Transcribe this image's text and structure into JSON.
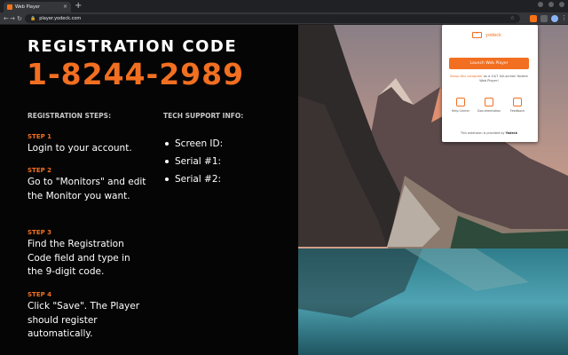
{
  "browser": {
    "tab_title": "Web Player",
    "tab_close": "×",
    "new_tab": "+",
    "url": "player.yodeck.com",
    "icons": {
      "favicon": "yodeck-favicon-icon",
      "back": "arrow-left-icon",
      "forward": "arrow-right-icon",
      "reload": "reload-icon",
      "lock": "lock-icon",
      "star": "star-icon",
      "extension": "yodeck-extension-icon",
      "puzzle": "puzzle-icon",
      "profile": "profile-icon",
      "menu": "more-vert-icon"
    }
  },
  "page": {
    "title": "REGISTRATION CODE",
    "code": "1-8244-2989",
    "steps_heading": "REGISTRATION STEPS:",
    "support_heading": "TECH SUPPORT INFO:",
    "steps": [
      {
        "label": "STEP 1",
        "text": "Login to your account."
      },
      {
        "label": "STEP 2",
        "text": "Go to \"Monitors\" and edit the Monitor you want."
      },
      {
        "label": "STEP 3",
        "text": "Find the Registration Code field and type in the 9-digit code."
      },
      {
        "label": "STEP 4",
        "text": "Click \"Save\". The Player should register automatically."
      }
    ],
    "support_items": [
      "Screen ID:",
      "Serial #1:",
      "Serial #2:"
    ],
    "accent_color": "#f26f21"
  },
  "popup": {
    "logo_text": "yodeck",
    "launch_label": "Launch Web Player",
    "desc_link": "Setup this computer",
    "desc_rest": "as a 24/7 full-screen Yodeck Web Player!",
    "icons": [
      {
        "name": "help-center-icon",
        "label": "Help Center"
      },
      {
        "name": "documentation-icon",
        "label": "Documentation"
      },
      {
        "name": "feedback-icon",
        "label": "Feedback"
      }
    ],
    "footer_prefix": "This extension is provided by",
    "footer_brand": "Yodeck"
  }
}
